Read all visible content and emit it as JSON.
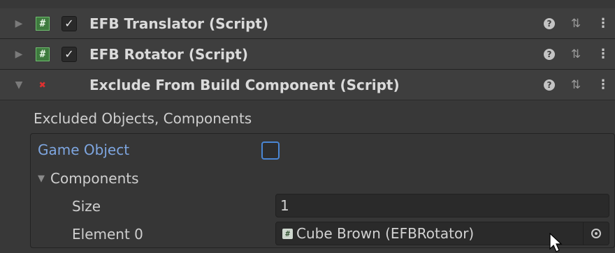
{
  "components": [
    {
      "title": "EFB Translator (Script)",
      "enabled": true,
      "expanded": false,
      "icon": "script-icon"
    },
    {
      "title": "EFB Rotator (Script)",
      "enabled": true,
      "expanded": false,
      "icon": "script-icon"
    },
    {
      "title": "Exclude From Build Component (Script)",
      "expanded": true,
      "icon": "missing-script-icon"
    }
  ],
  "header_icons": {
    "help": "?",
    "preset": "⇅",
    "menu": "⋮"
  },
  "exclude_panel": {
    "section_label": "Excluded Objects, Components",
    "game_object_label": "Game Object",
    "game_object_checked": false,
    "components_label": "Components",
    "size_label": "Size",
    "size_value": "1",
    "element_label": "Element 0",
    "element_value": "Cube Brown (EFBRotator)"
  },
  "colors": {
    "accent": "#4a86d4",
    "link_label": "#7ea6e0",
    "script_green": "#3e7a3e",
    "missing_red": "#e03030"
  }
}
